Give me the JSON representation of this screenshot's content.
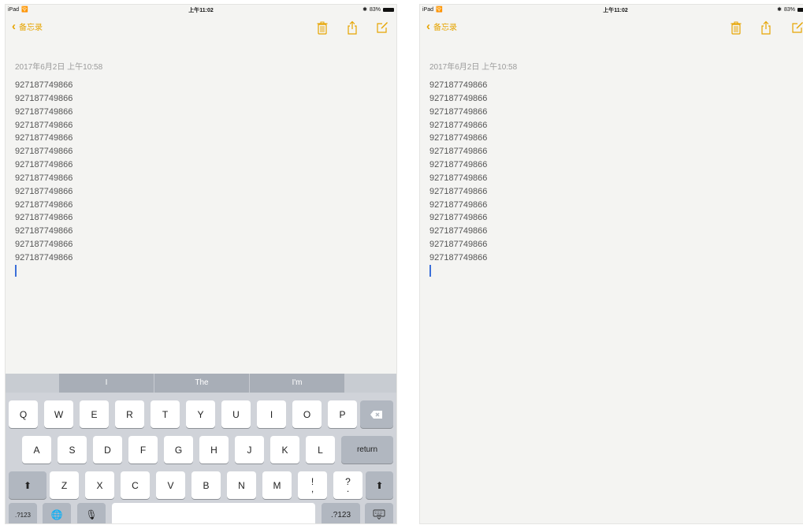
{
  "status": {
    "carrier": "iPad",
    "time": "上午11:02",
    "battery_percent": "83%"
  },
  "nav": {
    "back_label": "备忘录"
  },
  "note": {
    "date": "2017年6月2日 上午10:58",
    "lines": [
      "927187749866",
      "927187749866",
      "927187749866",
      "927187749866",
      "927187749866",
      "927187749866",
      "927187749866",
      "927187749866",
      "927187749866",
      "927187749866",
      "927187749866",
      "927187749866",
      "927187749866",
      "927187749866"
    ]
  },
  "keyboard": {
    "suggestions": [
      "I",
      "The",
      "I'm"
    ],
    "row1": [
      "Q",
      "W",
      "E",
      "R",
      "T",
      "Y",
      "U",
      "I",
      "O",
      "P"
    ],
    "row2": [
      "A",
      "S",
      "D",
      "F",
      "G",
      "H",
      "J",
      "K",
      "L"
    ],
    "row3": [
      "Z",
      "X",
      "C",
      "V",
      "B",
      "N",
      "M"
    ],
    "punct1": {
      "top": "!",
      "bottom": ","
    },
    "punct2": {
      "top": "?",
      "bottom": "."
    },
    "return_label": "return",
    "numbers_label": ".?123"
  },
  "colors": {
    "accent": "#e6a400",
    "background": "#f4f4f2",
    "cursor": "#3b6fd9",
    "keyboard": "#d0d3d9"
  },
  "icons": [
    "wifi-icon",
    "bluetooth-icon",
    "battery-icon",
    "back-chevron-icon",
    "trash-icon",
    "share-icon",
    "compose-icon",
    "delete-key-icon",
    "shift-icon",
    "globe-icon",
    "microphone-icon",
    "keyboard-dismiss-icon"
  ]
}
